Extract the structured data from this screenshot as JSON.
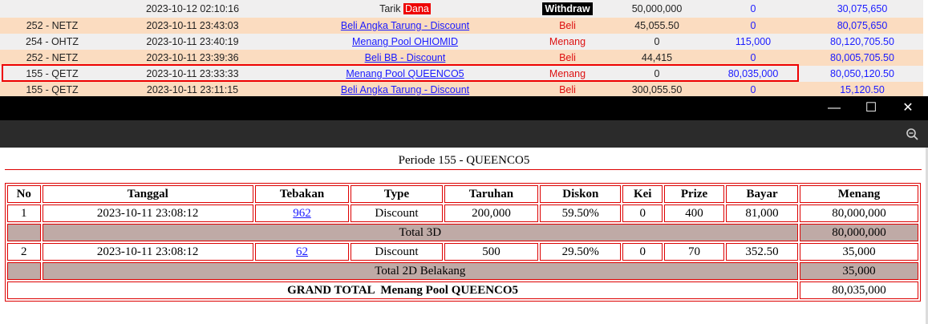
{
  "transactions": [
    {
      "user": "",
      "date": "2023-10-12 02:10:16",
      "desc_prefix": "Tarik",
      "desc_badge": "Dana",
      "type": "Withdraw",
      "debit": "50,000,000",
      "credit": "0",
      "balance": "30,075,650"
    },
    {
      "user": "252 - NETZ",
      "date": "2023-10-11 23:43:03",
      "desc": "Beli Angka Tarung - Discount",
      "type": "Beli",
      "debit": "45,055.50",
      "credit": "0",
      "balance": "80,075,650"
    },
    {
      "user": "254 - OHTZ",
      "date": "2023-10-11 23:40:19",
      "desc": "Menang Pool OHIOMID",
      "type": "Menang",
      "debit": "0",
      "credit": "115,000",
      "balance": "80,120,705.50"
    },
    {
      "user": "252 - NETZ",
      "date": "2023-10-11 23:39:36",
      "desc": "Beli BB - Discount",
      "type": "Beli",
      "debit": "44,415",
      "credit": "0",
      "balance": "80,005,705.50"
    },
    {
      "user": "155 - QETZ",
      "date": "2023-10-11 23:33:33",
      "desc": "Menang Pool QUEENCO5",
      "type": "Menang",
      "debit": "0",
      "credit": "80,035,000",
      "balance": "80,050,120.50"
    },
    {
      "user": "155 - QETZ",
      "date": "2023-10-11 23:11:15",
      "desc": "Beli Angka Tarung - Discount",
      "type": "Beli",
      "debit": "300,055.50",
      "credit": "0",
      "balance": "15,120.50"
    }
  ],
  "window": {
    "minimize": "—",
    "maximize": "☐",
    "close": "✕",
    "zoom_icon": "zoom-icon"
  },
  "detail": {
    "periode": "Periode 155 - QUEENCO5",
    "headers": [
      "No",
      "Tanggal",
      "Tebakan",
      "Type",
      "Taruhan",
      "Diskon",
      "Kei",
      "Prize",
      "Bayar",
      "Menang"
    ],
    "rows": [
      {
        "no": "1",
        "tanggal": "2023-10-11 23:08:12",
        "tebakan": "962",
        "type": "Discount",
        "taruhan": "200,000",
        "diskon": "59.50%",
        "kei": "0",
        "prize": "400",
        "bayar": "81,000",
        "menang": "80,000,000"
      },
      {
        "no": "2",
        "tanggal": "2023-10-11 23:08:12",
        "tebakan": "62",
        "type": "Discount",
        "taruhan": "500",
        "diskon": "29.50%",
        "kei": "0",
        "prize": "70",
        "bayar": "352.50",
        "menang": "35,000"
      }
    ],
    "totals": [
      {
        "label": "Total 3D",
        "value": "80,000,000"
      },
      {
        "label": "Total 2D Belakang",
        "value": "35,000"
      }
    ],
    "grand_total": {
      "label": "GRAND TOTAL  Menang Pool QUEENCO5",
      "value": "80,035,000"
    }
  },
  "colors": {
    "accent_red": "#dd0000",
    "row_peach": "#fbdcc0",
    "row_gray": "#f0efef",
    "total_bg": "#bfaaa6",
    "link_blue": "#1a1aff"
  }
}
